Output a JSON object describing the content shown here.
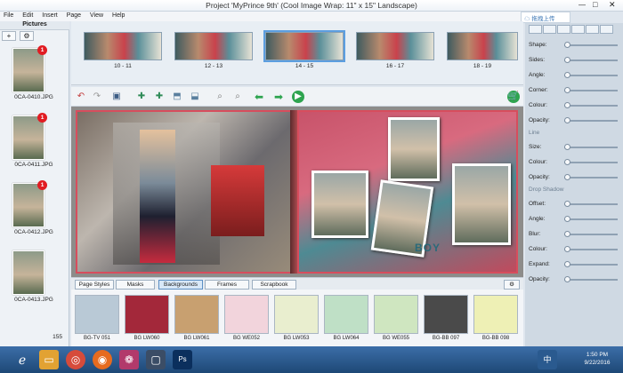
{
  "window": {
    "title": "Project 'MyPrince 9th' (Cool Image Wrap: 11\" x 15\" Landscape)"
  },
  "menu": [
    "File",
    "Edit",
    "Insert",
    "Page",
    "View",
    "Help"
  ],
  "translate": {
    "label": "拖拽上传"
  },
  "pictures": {
    "header": "Pictures",
    "toolbar": {
      "add": "+",
      "settings": "⚙"
    },
    "items": [
      {
        "name": "0CA-0410.JPG",
        "badge": "1"
      },
      {
        "name": "0CA-0411.JPG",
        "badge": "1"
      },
      {
        "name": "0CA-0412.JPG",
        "badge": "1"
      },
      {
        "name": "0CA-0413.JPG",
        "badge": ""
      }
    ],
    "count": "155"
  },
  "spreads": [
    {
      "label": "10 - 11"
    },
    {
      "label": "12 - 13"
    },
    {
      "label": "14 - 15"
    },
    {
      "label": "16 - 17"
    },
    {
      "label": "18 - 19"
    }
  ],
  "canvas": {
    "text": "BOY"
  },
  "tabs": [
    "Page Styles",
    "Masks",
    "Backgrounds",
    "Frames",
    "Scrapbook"
  ],
  "backgrounds": [
    {
      "name": "BG-TV 051",
      "color": "#b9c9d6"
    },
    {
      "name": "BG LW060",
      "color": "#a3283a"
    },
    {
      "name": "BG LW061",
      "color": "#c8a070"
    },
    {
      "name": "BG WE052",
      "color": "#f2d4dc"
    },
    {
      "name": "BG LW053",
      "color": "#e9eecf"
    },
    {
      "name": "BG LW064",
      "color": "#bfe0c6"
    },
    {
      "name": "BG WE055",
      "color": "#cfe6c0"
    },
    {
      "name": "BG-BB 097",
      "color": "#4a4a4a"
    },
    {
      "name": "BG-BB 098",
      "color": "#eef0b5"
    }
  ],
  "props": {
    "rows": [
      "Shape:",
      "Sides:",
      "Angle:",
      "Corner:",
      "Colour:",
      "Opacity:"
    ],
    "line_section": "Line",
    "line_rows": [
      "Size:",
      "Colour:",
      "Opacity:"
    ],
    "shadow_section": "Drop Shadow",
    "shadow_rows": [
      "Offset:",
      "Angle:",
      "Blur:",
      "Colour:",
      "Expand:",
      "Opacity:"
    ]
  },
  "taskbar": {
    "time": "1:50 PM",
    "date": "9/22/2016",
    "ime": "中"
  }
}
